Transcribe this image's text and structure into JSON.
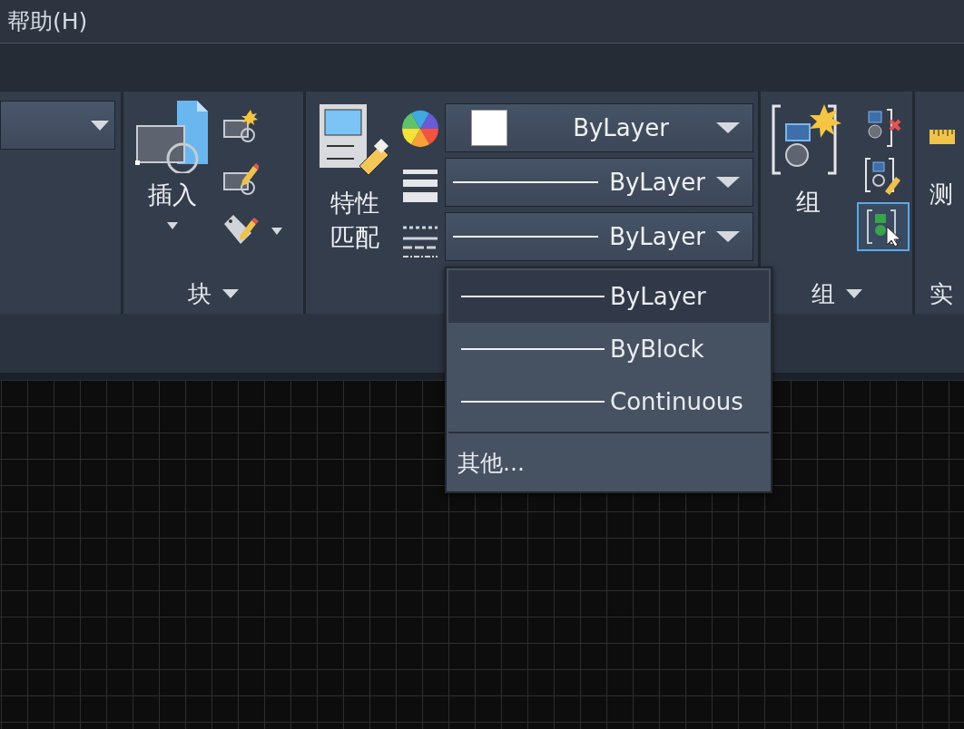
{
  "menu_bar": {
    "items": [
      {
        "label": "帮助(H)"
      }
    ]
  },
  "ribbon": {
    "block_panel": {
      "insert_label": "插入",
      "title": "块"
    },
    "properties_panel": {
      "match_label": [
        "特性",
        "匹配"
      ],
      "combos": [
        {
          "kind": "color",
          "value": "ByLayer"
        },
        {
          "kind": "lineweight",
          "value": "ByLayer"
        },
        {
          "kind": "linetype",
          "value": "ByLayer"
        }
      ]
    },
    "group_panel": {
      "group_label": "组",
      "title": "组",
      "select_toggle_on": true
    },
    "cut_panel": {
      "label": "测",
      "title": "实"
    }
  },
  "linetype_menu": {
    "items": [
      {
        "label": "ByLayer",
        "selected": true
      },
      {
        "label": "ByBlock",
        "selected": false
      },
      {
        "label": "Continuous",
        "selected": false
      }
    ],
    "more": "其他..."
  }
}
